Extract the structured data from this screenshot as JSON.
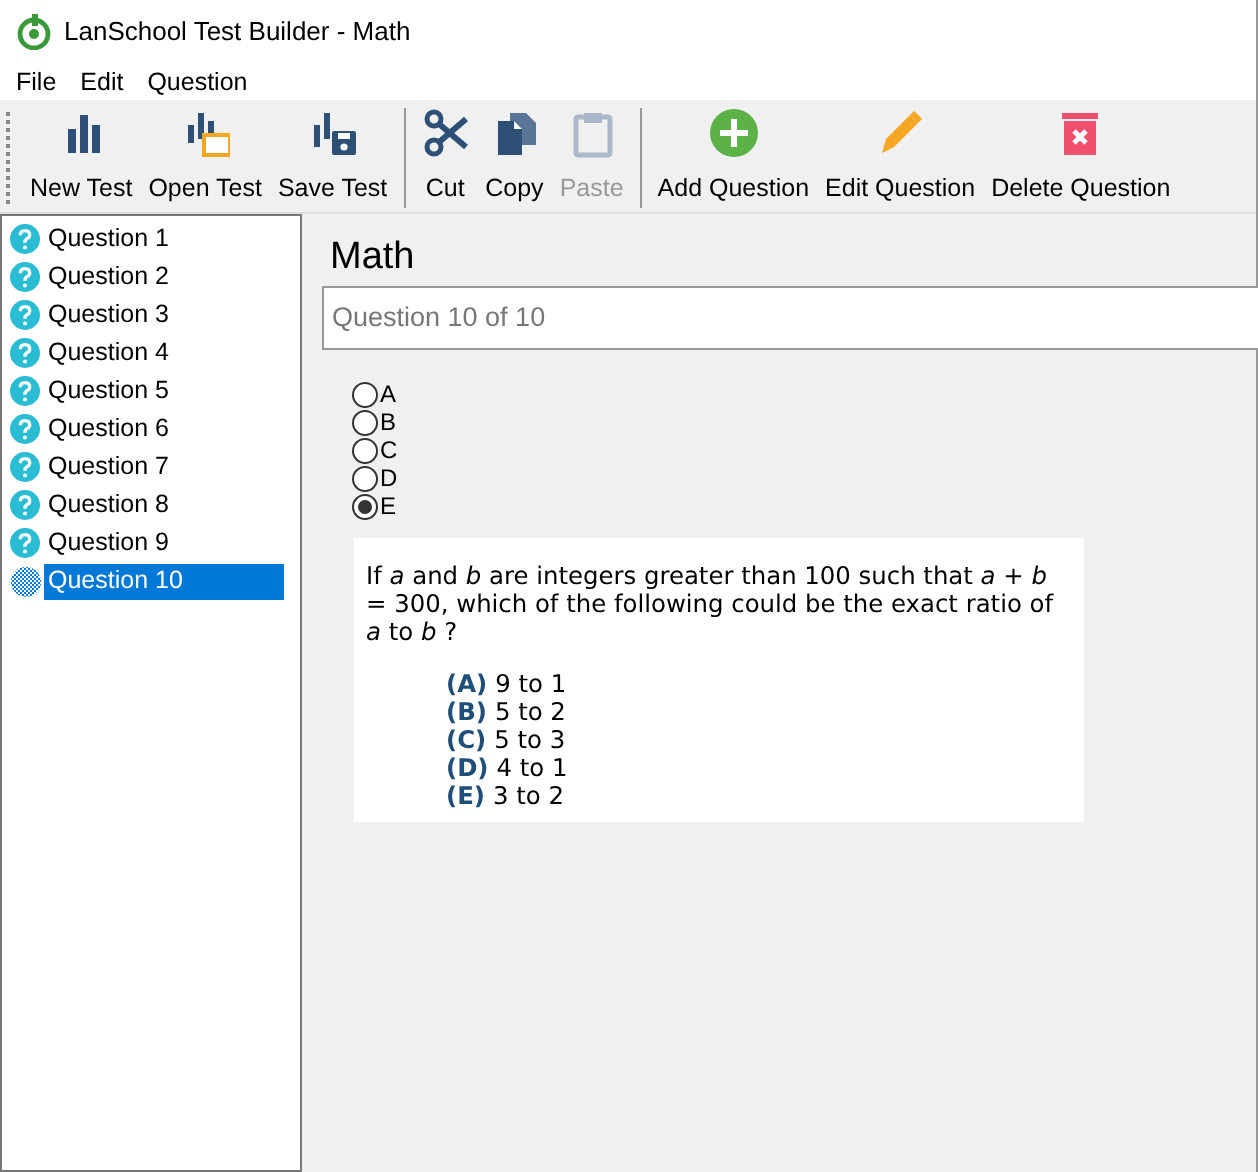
{
  "window": {
    "title": "LanSchool Test Builder - Math"
  },
  "menu": [
    "File",
    "Edit",
    "Question"
  ],
  "toolbar": [
    [
      {
        "label": "New Test",
        "kind": "new",
        "disabled": false
      },
      {
        "label": "Open Test",
        "kind": "open",
        "disabled": false
      },
      {
        "label": "Save Test",
        "kind": "save",
        "disabled": false
      }
    ],
    [
      {
        "label": "Cut",
        "kind": "cut",
        "disabled": false
      },
      {
        "label": "Copy",
        "kind": "copy",
        "disabled": false
      },
      {
        "label": "Paste",
        "kind": "paste",
        "disabled": true
      }
    ],
    [
      {
        "label": "Add Question",
        "kind": "add",
        "disabled": false
      },
      {
        "label": "Edit Question",
        "kind": "edit",
        "disabled": false
      },
      {
        "label": "Delete Question",
        "kind": "delete",
        "disabled": false
      }
    ]
  ],
  "questions": [
    {
      "label": "Question 1",
      "selected": false
    },
    {
      "label": "Question 2",
      "selected": false
    },
    {
      "label": "Question 3",
      "selected": false
    },
    {
      "label": "Question 4",
      "selected": false
    },
    {
      "label": "Question 5",
      "selected": false
    },
    {
      "label": "Question 6",
      "selected": false
    },
    {
      "label": "Question 7",
      "selected": false
    },
    {
      "label": "Question 8",
      "selected": false
    },
    {
      "label": "Question 9",
      "selected": false
    },
    {
      "label": "Question 10",
      "selected": true
    }
  ],
  "test_title": "Math",
  "question_counter": "Question 10 of 10",
  "answers": [
    {
      "label": "A",
      "selected": false
    },
    {
      "label": "B",
      "selected": false
    },
    {
      "label": "C",
      "selected": false
    },
    {
      "label": "D",
      "selected": false
    },
    {
      "label": "E",
      "selected": true
    }
  ],
  "question": {
    "text": "If *a* and *b* are integers greater than 100 such that *a* + *b* = 300, which of the following could be the exact ratio of *a* to *b* ?",
    "choices": [
      {
        "letter": "(A)",
        "text": "9 to 1"
      },
      {
        "letter": "(B)",
        "text": "5 to 2"
      },
      {
        "letter": "(C)",
        "text": "5 to 3"
      },
      {
        "letter": "(D)",
        "text": "4 to 1"
      },
      {
        "letter": "(E)",
        "text": "3 to 2"
      }
    ]
  }
}
